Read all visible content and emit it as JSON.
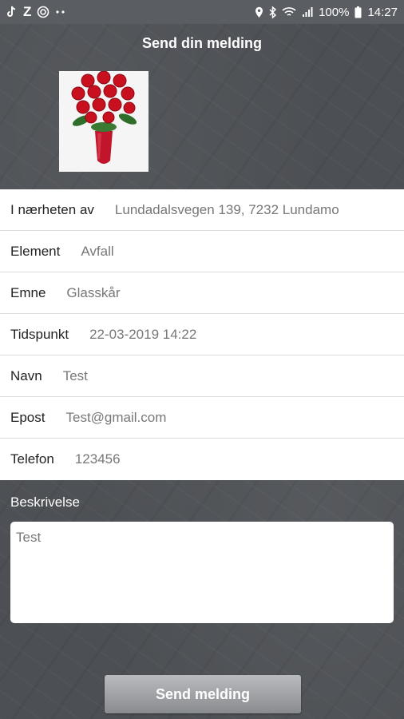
{
  "status_bar": {
    "battery_percent": "100%",
    "time": "14:27",
    "left_icons": [
      "tiktok-icon",
      "z-app-icon",
      "cast-icon",
      "more-dots-icon"
    ],
    "right_icons": [
      "location-icon",
      "bluetooth-icon",
      "wifi-icon",
      "signal-icon",
      "battery-icon"
    ]
  },
  "header": {
    "title": "Send din melding"
  },
  "photo": {
    "icon": "roses-photo"
  },
  "form": {
    "rows": [
      {
        "label": "I nærheten av",
        "value": "Lundadalsvegen 139, 7232 Lundamo"
      },
      {
        "label": "Element",
        "value": "Avfall"
      },
      {
        "label": "Emne",
        "value": "Glasskår"
      },
      {
        "label": "Tidspunkt",
        "value": "22-03-2019 14:22"
      },
      {
        "label": "Navn",
        "value": "Test"
      },
      {
        "label": "Epost",
        "value": "Test@gmail.com"
      },
      {
        "label": "Telefon",
        "value": "123456"
      }
    ]
  },
  "description": {
    "label": "Beskrivelse",
    "value": "Test"
  },
  "actions": {
    "send_label": "Send melding"
  },
  "colors": {
    "background": "#4c4f53",
    "status_bar": "#5a5d61",
    "button_top": "#b9bbbe",
    "button_bottom": "#888b8f",
    "value_text": "#777777"
  }
}
